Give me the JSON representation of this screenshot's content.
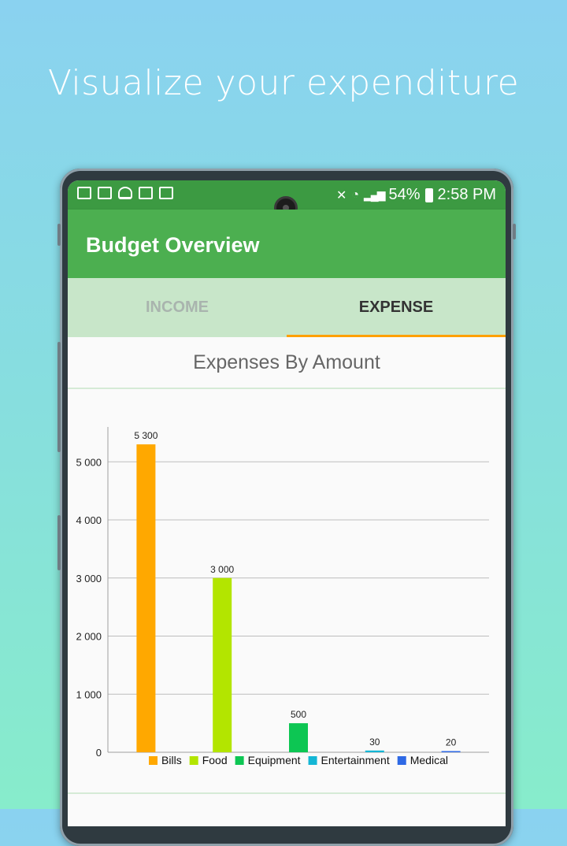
{
  "headline": "Visualize your expenditure",
  "status_bar": {
    "left_icons": [
      "calendar-30-icon",
      "calendar-icon",
      "bell-icon",
      "image-icon",
      "activity-icon"
    ],
    "battery": "54%",
    "time": "2:58 PM"
  },
  "app_bar": {
    "title": "Budget Overview"
  },
  "tabs": [
    {
      "label": "INCOME",
      "active": false
    },
    {
      "label": "EXPENSE",
      "active": true
    }
  ],
  "chart_title": "Expenses By Amount",
  "colors": {
    "status_bar": "#3c9a42",
    "app_bar": "#4caf50",
    "tabs_bg": "#c8e6c9",
    "tab_indicator": "#ffa000"
  },
  "chart_data": {
    "type": "bar",
    "title": "Expenses By Amount",
    "categories": [
      "Bills",
      "Food",
      "Equipment",
      "Entertainment",
      "Medical"
    ],
    "values": [
      5300,
      3000,
      500,
      30,
      20
    ],
    "value_labels": [
      "5 300",
      "3 000",
      "500",
      "30",
      "20"
    ],
    "colors": [
      "#ffa800",
      "#b3e500",
      "#0dc653",
      "#14b6d5",
      "#2e69e5"
    ],
    "ylim": [
      0,
      5600
    ],
    "yticks": [
      0,
      1000,
      2000,
      3000,
      4000,
      5000
    ],
    "ytick_labels": [
      "0",
      "1 000",
      "2 000",
      "3 000",
      "4 000",
      "5 000"
    ],
    "grid": true,
    "legend": "bottom"
  }
}
